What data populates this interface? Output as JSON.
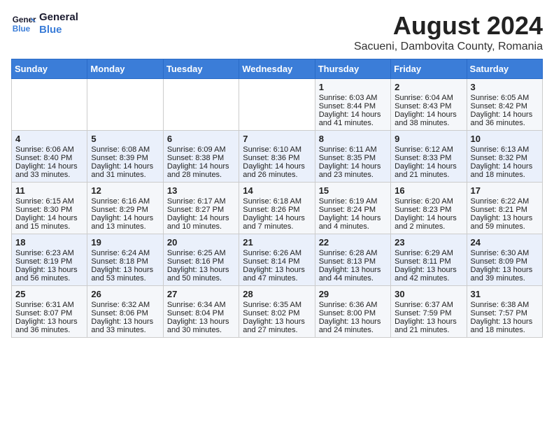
{
  "logo": {
    "line1": "General",
    "line2": "Blue"
  },
  "title": "August 2024",
  "subtitle": "Sacueni, Dambovita County, Romania",
  "weekdays": [
    "Sunday",
    "Monday",
    "Tuesday",
    "Wednesday",
    "Thursday",
    "Friday",
    "Saturday"
  ],
  "weeks": [
    [
      {
        "day": "",
        "info": ""
      },
      {
        "day": "",
        "info": ""
      },
      {
        "day": "",
        "info": ""
      },
      {
        "day": "",
        "info": ""
      },
      {
        "day": "1",
        "info": "Sunrise: 6:03 AM\nSunset: 8:44 PM\nDaylight: 14 hours and 41 minutes."
      },
      {
        "day": "2",
        "info": "Sunrise: 6:04 AM\nSunset: 8:43 PM\nDaylight: 14 hours and 38 minutes."
      },
      {
        "day": "3",
        "info": "Sunrise: 6:05 AM\nSunset: 8:42 PM\nDaylight: 14 hours and 36 minutes."
      }
    ],
    [
      {
        "day": "4",
        "info": "Sunrise: 6:06 AM\nSunset: 8:40 PM\nDaylight: 14 hours and 33 minutes."
      },
      {
        "day": "5",
        "info": "Sunrise: 6:08 AM\nSunset: 8:39 PM\nDaylight: 14 hours and 31 minutes."
      },
      {
        "day": "6",
        "info": "Sunrise: 6:09 AM\nSunset: 8:38 PM\nDaylight: 14 hours and 28 minutes."
      },
      {
        "day": "7",
        "info": "Sunrise: 6:10 AM\nSunset: 8:36 PM\nDaylight: 14 hours and 26 minutes."
      },
      {
        "day": "8",
        "info": "Sunrise: 6:11 AM\nSunset: 8:35 PM\nDaylight: 14 hours and 23 minutes."
      },
      {
        "day": "9",
        "info": "Sunrise: 6:12 AM\nSunset: 8:33 PM\nDaylight: 14 hours and 21 minutes."
      },
      {
        "day": "10",
        "info": "Sunrise: 6:13 AM\nSunset: 8:32 PM\nDaylight: 14 hours and 18 minutes."
      }
    ],
    [
      {
        "day": "11",
        "info": "Sunrise: 6:15 AM\nSunset: 8:30 PM\nDaylight: 14 hours and 15 minutes."
      },
      {
        "day": "12",
        "info": "Sunrise: 6:16 AM\nSunset: 8:29 PM\nDaylight: 14 hours and 13 minutes."
      },
      {
        "day": "13",
        "info": "Sunrise: 6:17 AM\nSunset: 8:27 PM\nDaylight: 14 hours and 10 minutes."
      },
      {
        "day": "14",
        "info": "Sunrise: 6:18 AM\nSunset: 8:26 PM\nDaylight: 14 hours and 7 minutes."
      },
      {
        "day": "15",
        "info": "Sunrise: 6:19 AM\nSunset: 8:24 PM\nDaylight: 14 hours and 4 minutes."
      },
      {
        "day": "16",
        "info": "Sunrise: 6:20 AM\nSunset: 8:23 PM\nDaylight: 14 hours and 2 minutes."
      },
      {
        "day": "17",
        "info": "Sunrise: 6:22 AM\nSunset: 8:21 PM\nDaylight: 13 hours and 59 minutes."
      }
    ],
    [
      {
        "day": "18",
        "info": "Sunrise: 6:23 AM\nSunset: 8:19 PM\nDaylight: 13 hours and 56 minutes."
      },
      {
        "day": "19",
        "info": "Sunrise: 6:24 AM\nSunset: 8:18 PM\nDaylight: 13 hours and 53 minutes."
      },
      {
        "day": "20",
        "info": "Sunrise: 6:25 AM\nSunset: 8:16 PM\nDaylight: 13 hours and 50 minutes."
      },
      {
        "day": "21",
        "info": "Sunrise: 6:26 AM\nSunset: 8:14 PM\nDaylight: 13 hours and 47 minutes."
      },
      {
        "day": "22",
        "info": "Sunrise: 6:28 AM\nSunset: 8:13 PM\nDaylight: 13 hours and 44 minutes."
      },
      {
        "day": "23",
        "info": "Sunrise: 6:29 AM\nSunset: 8:11 PM\nDaylight: 13 hours and 42 minutes."
      },
      {
        "day": "24",
        "info": "Sunrise: 6:30 AM\nSunset: 8:09 PM\nDaylight: 13 hours and 39 minutes."
      }
    ],
    [
      {
        "day": "25",
        "info": "Sunrise: 6:31 AM\nSunset: 8:07 PM\nDaylight: 13 hours and 36 minutes."
      },
      {
        "day": "26",
        "info": "Sunrise: 6:32 AM\nSunset: 8:06 PM\nDaylight: 13 hours and 33 minutes."
      },
      {
        "day": "27",
        "info": "Sunrise: 6:34 AM\nSunset: 8:04 PM\nDaylight: 13 hours and 30 minutes."
      },
      {
        "day": "28",
        "info": "Sunrise: 6:35 AM\nSunset: 8:02 PM\nDaylight: 13 hours and 27 minutes."
      },
      {
        "day": "29",
        "info": "Sunrise: 6:36 AM\nSunset: 8:00 PM\nDaylight: 13 hours and 24 minutes."
      },
      {
        "day": "30",
        "info": "Sunrise: 6:37 AM\nSunset: 7:59 PM\nDaylight: 13 hours and 21 minutes."
      },
      {
        "day": "31",
        "info": "Sunrise: 6:38 AM\nSunset: 7:57 PM\nDaylight: 13 hours and 18 minutes."
      }
    ]
  ]
}
